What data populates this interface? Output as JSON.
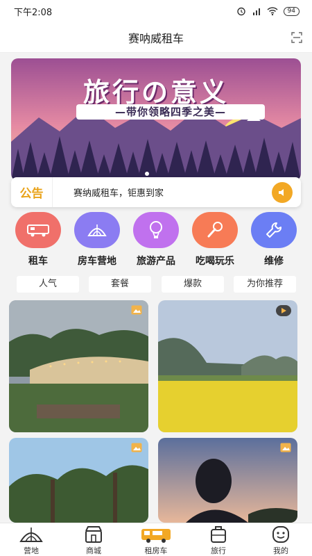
{
  "status": {
    "time": "下午2:08",
    "battery": "94"
  },
  "header": {
    "title": "赛呐威租车"
  },
  "banner": {
    "title": "旅行の意义",
    "subtitle": "—带你领略四季之美—"
  },
  "notice": {
    "logo_text": "公告",
    "text": "赛纳威租车，钜惠到家"
  },
  "categories": [
    {
      "label": "租车",
      "icon": "car-icon",
      "color": "#f0706a"
    },
    {
      "label": "房车营地",
      "icon": "tent-icon",
      "color": "#8b7cf2"
    },
    {
      "label": "旅游产品",
      "icon": "balloon-icon",
      "color": "#c071ee"
    },
    {
      "label": "吃喝玩乐",
      "icon": "microphone-icon",
      "color": "#f77b56"
    },
    {
      "label": "维修",
      "icon": "wrench-icon",
      "color": "#6b7ef4"
    }
  ],
  "tabs": [
    "人气",
    "套餐",
    "爆款",
    "为你推荐"
  ],
  "cards": [
    {
      "media": "image-icon",
      "scene": "campsite at dusk"
    },
    {
      "media": "play-icon",
      "scene": "rapeseed flower field"
    },
    {
      "media": "image-icon",
      "scene": "trees and sky"
    },
    {
      "media": "image-icon",
      "scene": "silhouette at sunset"
    }
  ],
  "nav": [
    {
      "label": "营地",
      "icon": "tent-icon"
    },
    {
      "label": "商城",
      "icon": "shop-icon"
    },
    {
      "label": "租房车",
      "icon": "rv-icon"
    },
    {
      "label": "旅行",
      "icon": "luggage-icon"
    },
    {
      "label": "我的",
      "icon": "face-icon"
    }
  ],
  "colors": {
    "accent": "#f2a825",
    "notice_logo": "#e9a31a"
  }
}
